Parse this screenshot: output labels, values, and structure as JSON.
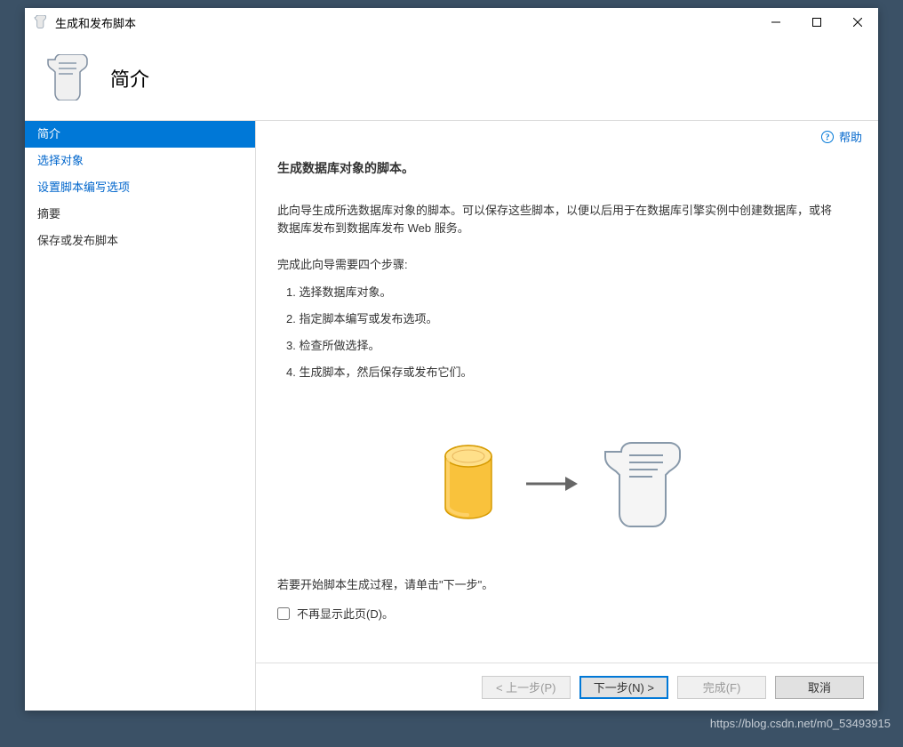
{
  "window": {
    "title": "生成和发布脚本"
  },
  "header": {
    "title": "简介"
  },
  "sidebar": {
    "items": [
      {
        "label": "简介",
        "active": true,
        "plain": false
      },
      {
        "label": "选择对象",
        "active": false,
        "plain": false
      },
      {
        "label": "设置脚本编写选项",
        "active": false,
        "plain": false
      },
      {
        "label": "摘要",
        "active": false,
        "plain": true
      },
      {
        "label": "保存或发布脚本",
        "active": false,
        "plain": true
      }
    ]
  },
  "help": {
    "label": "帮助"
  },
  "content": {
    "heading": "生成数据库对象的脚本。",
    "paragraph": "此向导生成所选数据库对象的脚本。可以保存这些脚本，以便以后用于在数据库引擎实例中创建数据库，或将数据库发布到数据库发布 Web 服务。",
    "steps_intro": "完成此向导需要四个步骤:",
    "steps": [
      "1.  选择数据库对象。",
      "2.  指定脚本编写或发布选项。",
      "3.  检查所做选择。",
      "4.  生成脚本，然后保存或发布它们。"
    ],
    "start_text": "若要开始脚本生成过程，请单击\"下一步\"。",
    "checkbox_label": "不再显示此页(D)。"
  },
  "footer": {
    "prev": "< 上一步(P)",
    "next": "下一步(N) >",
    "finish": "完成(F)",
    "cancel": "取消"
  },
  "watermark": "https://blog.csdn.net/m0_53493915"
}
